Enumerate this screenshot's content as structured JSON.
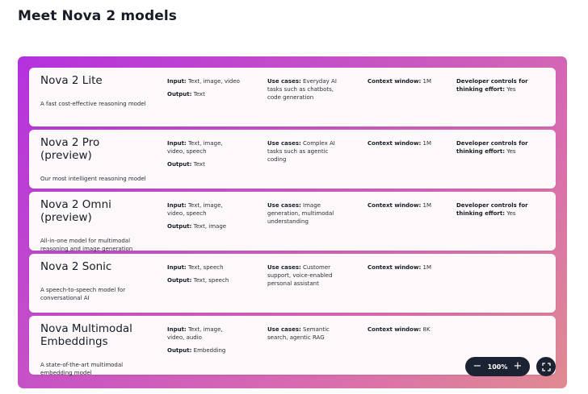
{
  "page": {
    "title": "Meet Nova 2 models"
  },
  "models": [
    {
      "name_lines": [
        "Nova 2 Lite"
      ],
      "desc_lines": [
        "A fast cost-effective reasoning model"
      ],
      "input_label": "Input:",
      "input_lines": [
        "Text, image, video"
      ],
      "output_label": "Output:",
      "output": "Text",
      "usecases_label": "Use cases:",
      "usecases_lines": [
        "Everyday AI",
        "tasks such as chatbots,",
        "code generation"
      ],
      "context_label": "Context window:",
      "context": "1M",
      "dev_lines": [
        "Developer controls for",
        "thinking effort:"
      ],
      "dev_value": "Yes"
    },
    {
      "name_lines": [
        "Nova 2 Pro",
        "(preview)"
      ],
      "desc_lines": [
        "Our most intelligent reasoning model"
      ],
      "input_label": "Input:",
      "input_lines": [
        "Text, image,",
        "video, speech"
      ],
      "output_label": "Output:",
      "output": "Text",
      "usecases_label": "Use cases:",
      "usecases_lines": [
        "Complex AI",
        "tasks such as agentic",
        "coding"
      ],
      "context_label": "Context window:",
      "context": "1M",
      "dev_lines": [
        "Developer controls for",
        "thinking effort:"
      ],
      "dev_value": "Yes"
    },
    {
      "name_lines": [
        "Nova 2 Omni",
        "(preview)"
      ],
      "desc_lines": [
        "All-in-one model for multimodal",
        "reasoning and image generation"
      ],
      "input_label": "Input:",
      "input_lines": [
        "Text, image,",
        "video, speech"
      ],
      "output_label": "Output:",
      "output": "Text, image",
      "usecases_label": "Use cases:",
      "usecases_lines": [
        "Image",
        "generation, multimodal",
        "understanding"
      ],
      "context_label": "Context window:",
      "context": "1M",
      "dev_lines": [
        "Developer controls for",
        "thinking effort:"
      ],
      "dev_value": "Yes"
    },
    {
      "name_lines": [
        "Nova 2 Sonic"
      ],
      "desc_lines": [
        "A speech-to-speech model for",
        "conversational AI"
      ],
      "input_label": "Input:",
      "input_lines": [
        "Text, speech"
      ],
      "output_label": "Output:",
      "output": "Text, speech",
      "usecases_label": "Use cases:",
      "usecases_lines": [
        "Customer",
        "support, voice-enabled",
        "personal assistant"
      ],
      "context_label": "Context window:",
      "context": "1M",
      "dev_lines": [],
      "dev_value": ""
    },
    {
      "name_lines": [
        "Nova Multimodal",
        "Embeddings"
      ],
      "desc_lines": [
        "A state-of-the-art multimodal",
        "embedding model"
      ],
      "input_label": "Input:",
      "input_lines": [
        "Text, image,",
        "video, audio"
      ],
      "output_label": "Output:",
      "output": "Embedding",
      "usecases_label": "Use cases:",
      "usecases_lines": [
        "Semantic",
        "search, agentic RAG"
      ],
      "context_label": "Context window:",
      "context": "8K",
      "dev_lines": [],
      "dev_value": ""
    }
  ],
  "zoom": {
    "level": "100%",
    "minus": "−",
    "plus": "+"
  }
}
